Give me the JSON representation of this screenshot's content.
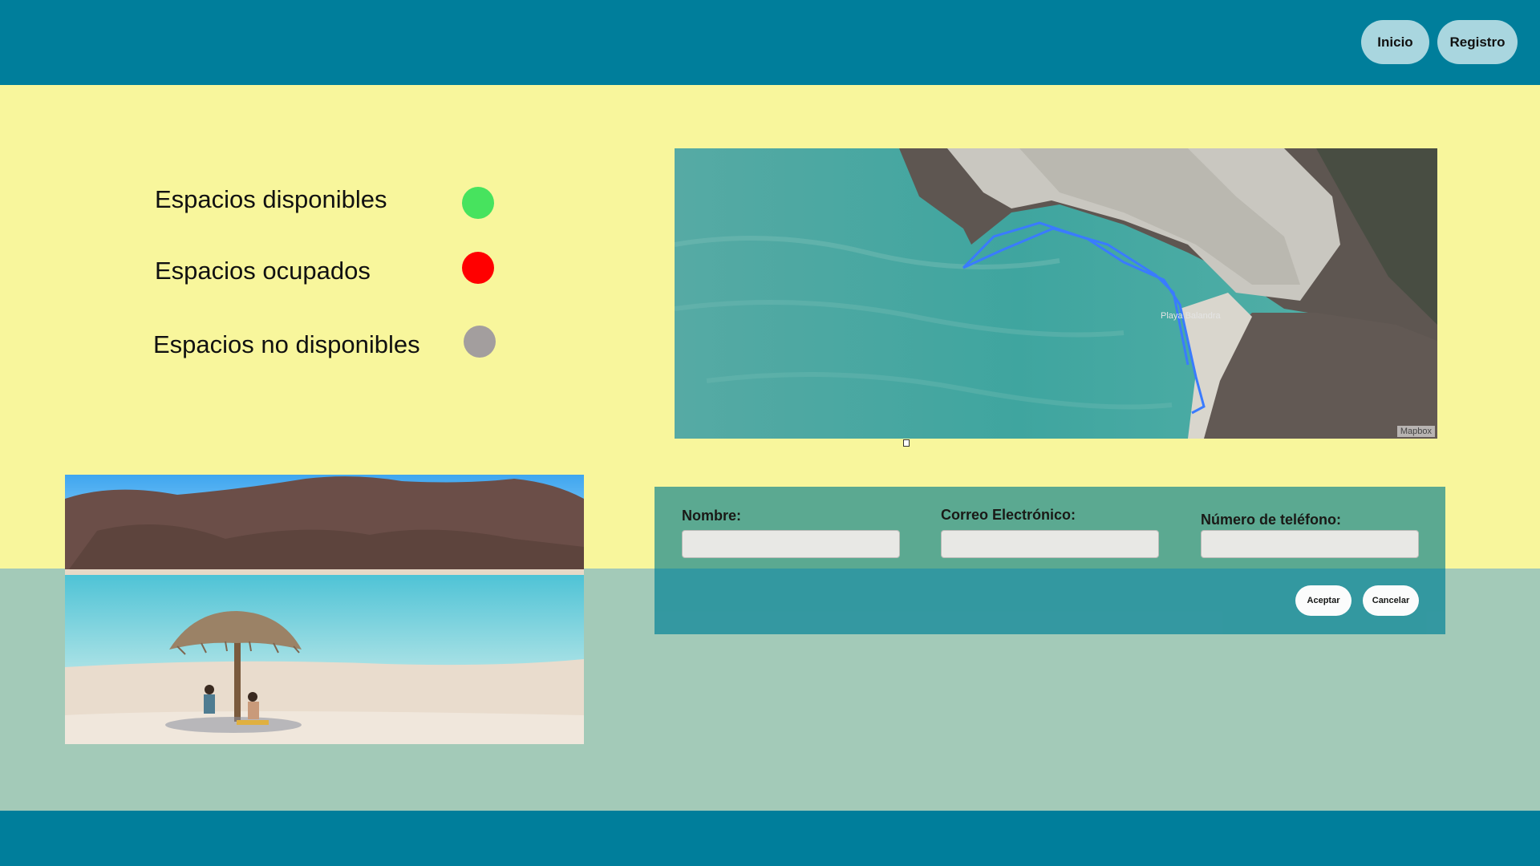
{
  "nav": {
    "inicio_label": "Inicio",
    "registro_label": "Registro"
  },
  "legend": {
    "items": [
      {
        "label": "Espacios disponibles",
        "color": "#47e35e"
      },
      {
        "label": "Espacios ocupados",
        "color": "#ff0000"
      },
      {
        "label": "Espacios no disponibles",
        "color": "#a39e9e"
      }
    ]
  },
  "map": {
    "place_label": "Playa Balandra",
    "credit": "Mapbox"
  },
  "form": {
    "nombre_label": "Nombre:",
    "nombre_value": "",
    "correo_label": "Correo Electrónico:",
    "correo_value": "",
    "telefono_label": "Número de teléfono:",
    "telefono_value": "",
    "aceptar_label": "Aceptar",
    "cancelar_label": "Cancelar"
  },
  "colors": {
    "header": "#007e9b",
    "page_background": "#f8f69c",
    "lower_band": "#a3cab8",
    "form_panel": "#2f96a0",
    "nav_button": "#a9d6df"
  }
}
